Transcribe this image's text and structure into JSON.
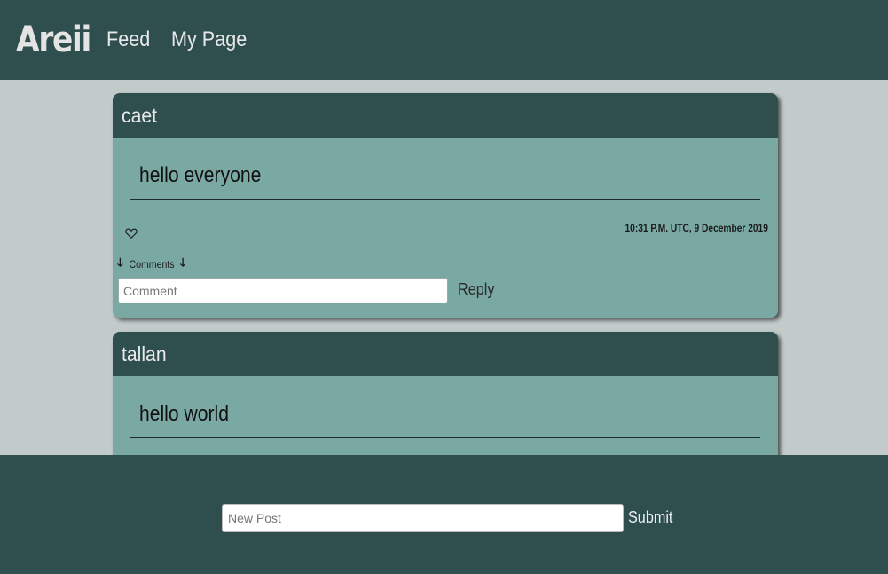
{
  "nav": {
    "brand": "Areii",
    "links": [
      "Feed",
      "My Page"
    ]
  },
  "posts": [
    {
      "author": "caet",
      "content": "hello everyone",
      "timestamp": "10:31 P.M. UTC, 9 December 2019",
      "comments_label": "Comments",
      "comment_placeholder": "Comment",
      "reply_label": "Reply"
    },
    {
      "author": "tallan",
      "content": "hello world"
    }
  ],
  "footer": {
    "new_post_placeholder": "New Post",
    "submit_label": "Submit"
  },
  "icons": {
    "like": "heart-outline-icon",
    "expand": "arrow-down-icon"
  },
  "colors": {
    "header": "#2f4f4f",
    "card": "#7aa9a4",
    "background": "#c3cbca"
  }
}
